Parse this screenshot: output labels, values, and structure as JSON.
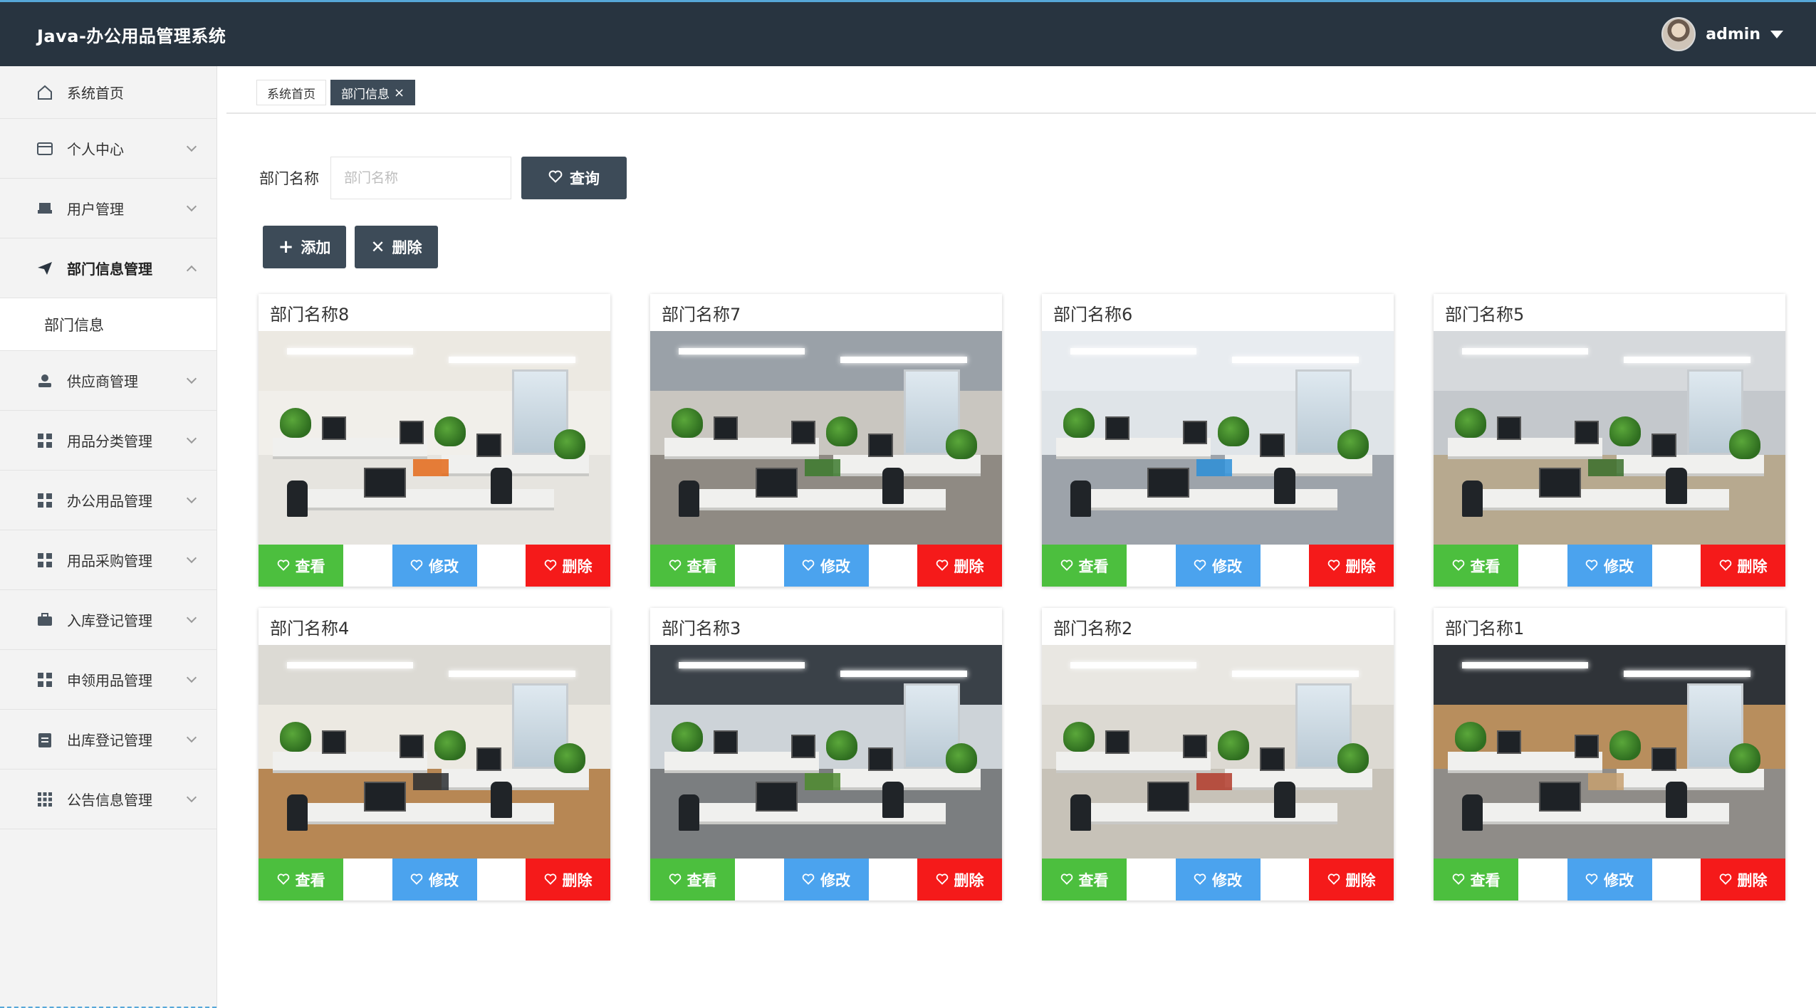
{
  "app": {
    "title": "Java-办公用品管理系统"
  },
  "user": {
    "name": "admin"
  },
  "sidebar": {
    "items": [
      {
        "label": "系统首页",
        "icon": "home-icon",
        "expanded": null
      },
      {
        "label": "个人中心",
        "icon": "wallet-icon",
        "expanded": false
      },
      {
        "label": "用户管理",
        "icon": "printer-icon",
        "expanded": false
      },
      {
        "label": "部门信息管理",
        "icon": "paper-plane-icon",
        "expanded": true
      },
      {
        "label": "供应商管理",
        "icon": "person-icon",
        "expanded": false
      },
      {
        "label": "用品分类管理",
        "icon": "grid-icon",
        "expanded": false
      },
      {
        "label": "办公用品管理",
        "icon": "grid-icon",
        "expanded": false
      },
      {
        "label": "用品采购管理",
        "icon": "grid-icon",
        "expanded": false
      },
      {
        "label": "入库登记管理",
        "icon": "briefcase-icon",
        "expanded": false
      },
      {
        "label": "申领用品管理",
        "icon": "grid-icon",
        "expanded": false
      },
      {
        "label": "出库登记管理",
        "icon": "clipboard-icon",
        "expanded": false
      },
      {
        "label": "公告信息管理",
        "icon": "grid9-icon",
        "expanded": false
      }
    ],
    "subitem": "部门信息"
  },
  "tabs": [
    {
      "label": "系统首页",
      "active": false
    },
    {
      "label": "部门信息",
      "active": true,
      "close": "×"
    }
  ],
  "search": {
    "label": "部门名称",
    "placeholder": "部门名称",
    "value": "",
    "button": "查询"
  },
  "actions": {
    "add": "添加",
    "delete": "删除"
  },
  "card_buttons": {
    "view": "查看",
    "edit": "修改",
    "delete": "删除"
  },
  "cards": [
    {
      "title": "部门名称8"
    },
    {
      "title": "部门名称7"
    },
    {
      "title": "部门名称6"
    },
    {
      "title": "部门名称5"
    },
    {
      "title": "部门名称4"
    },
    {
      "title": "部门名称3"
    },
    {
      "title": "部门名称2"
    },
    {
      "title": "部门名称1"
    }
  ],
  "colors": {
    "topbar": "#283440",
    "dark_button": "#3d4b58",
    "view": "#4cbf3e",
    "edit": "#4ba3ee",
    "delete": "#f51a1a"
  }
}
